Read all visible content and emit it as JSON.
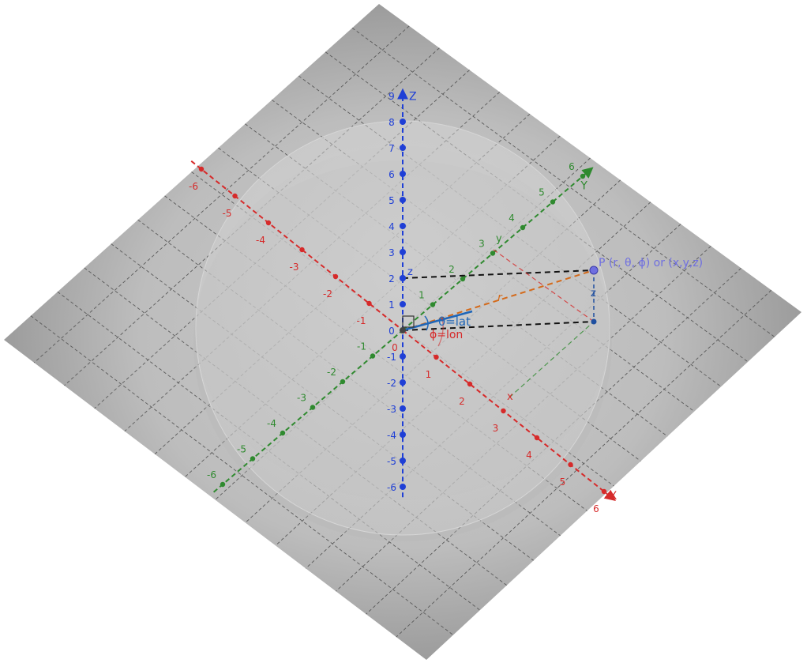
{
  "colors": {
    "x_axis": "#d62a2a",
    "y_axis": "#2f8a2f",
    "z_axis": "#1f3fd6",
    "point": "#6f6fe0",
    "radius": "#d46a1a",
    "angle_theta": "#1f66b8",
    "angle_phi": "#d62a2a",
    "guide": "#111111",
    "plane_grid": "#666666"
  },
  "axes": {
    "x": {
      "name": "X",
      "ticks": [
        "-6",
        "-5",
        "-4",
        "-3",
        "-2",
        "-1",
        "0",
        "1",
        "2",
        "3",
        "4",
        "5",
        "6"
      ]
    },
    "y": {
      "name": "Y",
      "ticks": [
        "-6",
        "-5",
        "-4",
        "-3",
        "-2",
        "-1",
        "1",
        "2",
        "3",
        "4",
        "5",
        "6"
      ]
    },
    "z": {
      "name": "Z",
      "ticks": [
        "-6",
        "-5",
        "-4",
        "-3",
        "-2",
        "-1",
        "0",
        "1",
        "2",
        "3",
        "4",
        "5",
        "6",
        "7",
        "8",
        "9"
      ]
    }
  },
  "labels": {
    "point": "P (r, θ, ϕ) or (x,y,z)",
    "r": "r",
    "z_on_axis": "z",
    "z_vertical": "z",
    "theta": "θ=lat",
    "phi": "ϕ=lon",
    "x_mark": "x",
    "y_mark": "y"
  }
}
